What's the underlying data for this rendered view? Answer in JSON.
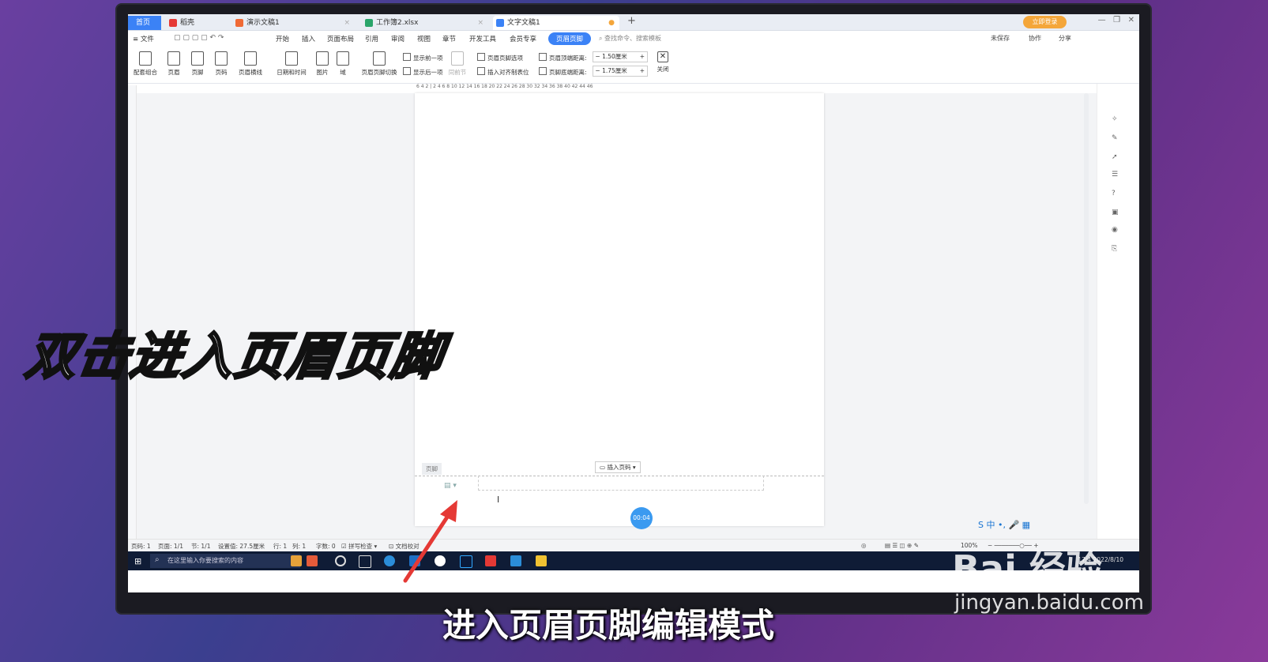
{
  "tabs": [
    {
      "label": "首页",
      "kind": "home"
    },
    {
      "label": "稻壳",
      "kind": "normal"
    },
    {
      "label": "演示文稿1",
      "kind": "normal"
    },
    {
      "label": "工作簿2.xlsx",
      "kind": "normal"
    },
    {
      "label": "文字文稿1",
      "kind": "active"
    }
  ],
  "login_label": "立即登录",
  "menu": [
    "≡ 文件",
    "开始",
    "插入",
    "页面布局",
    "引用",
    "审阅",
    "视图",
    "章节",
    "开发工具",
    "会员专享"
  ],
  "menu_active": "页眉页脚",
  "search_placeholder": "查找命令、搜索模板",
  "right_menu": [
    "未保存",
    "协作",
    "分享"
  ],
  "ribbon_buttons": [
    "配套组合",
    "页眉",
    "页脚",
    "页码",
    "页眉横线",
    "日期和时间",
    "图片",
    "域",
    "页眉页脚切换"
  ],
  "ribbon_small": [
    "显示前一项",
    "显示后一项",
    "同前节",
    "页眉页脚选项",
    "插入对齐制表位",
    "页眉顶端距离:",
    "页脚底端距离:"
  ],
  "header_top_distance": "1.50厘米",
  "footer_bottom_distance": "1.75厘米",
  "close_label": "关闭",
  "ruler_ticks": "6  4  2  |  2  4  6  8  10  12  14  16  18  20  22  24  26  28  30  32  34  36  38  40  42  44  46",
  "footer_tag": "页脚",
  "insert_page_number": "插入页码",
  "timer": "00:04",
  "status": {
    "page_num": "页码: 1",
    "pages": "页面: 1/1",
    "section": "节: 1/1",
    "setting": "设置值: 27.5厘米",
    "row": "行: 1",
    "col": "列: 1",
    "words": "字数: 0",
    "spell": "拼写检查",
    "proof": "文档校对",
    "zoom": "100%"
  },
  "taskbar_search": "在这里输入你要搜索的内容",
  "tray_time": "17:4",
  "tray_date": "2022/8/10",
  "overlay_title": "双击进入页眉页脚",
  "overlay_subtitle": "进入页眉页脚编辑模式",
  "watermark_brand": "Bai 经验",
  "watermark_url": "jingyan.baidu.com",
  "ime_label": "S 中 •, 🎤 ▦",
  "colors": {
    "accent": "#3b82f6",
    "login": "#f4a63a",
    "taskbar": "#0f1c36",
    "arrow": "#e53935"
  }
}
